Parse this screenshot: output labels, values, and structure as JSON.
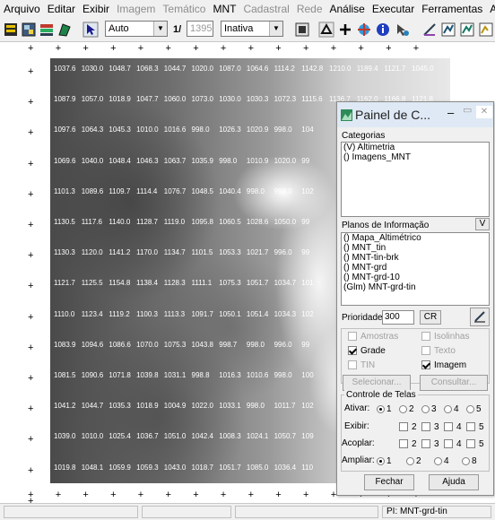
{
  "menu": [
    "Arquivo",
    "Editar",
    "Exibir",
    "Imagem",
    "Temático",
    "MNT",
    "Cadastral",
    "Rede",
    "Análise",
    "Executar",
    "Ferramentas",
    "Ajuda"
  ],
  "menu_disabled": [
    "Imagem",
    "Temático",
    "Cadastral",
    "Rede"
  ],
  "toolbar": {
    "mode_value": "Auto",
    "scale_prefix": "1/",
    "scale_value": "1395",
    "state_value": "Inativa"
  },
  "grid_rows": [
    [
      "1037.6",
      "1030.0",
      "1048.7",
      "1068.3",
      "1044.7",
      "1020.0",
      "1087.0",
      "1064.6",
      "1114.2",
      "1142.8",
      "1210.0",
      "1189.4",
      "1121.7",
      "1045.0"
    ],
    [
      "1087.9",
      "1057.0",
      "1018.9",
      "1047.7",
      "1060.0",
      "1073.0",
      "1030.0",
      "1030.3",
      "1072.3",
      "1115.6",
      "1136.7",
      "1162.0",
      "1166.8",
      "1121.8"
    ],
    [
      "1097.6",
      "1064.3",
      "1045.3",
      "1010.0",
      "1016.6",
      "998.0",
      "1026.3",
      "1020.9",
      "998.0",
      "104"
    ],
    [
      "1069.6",
      "1040.0",
      "1048.4",
      "1046.3",
      "1063.7",
      "1035.9",
      "998.0",
      "1010.9",
      "1020.0",
      "99"
    ],
    [
      "1101.3",
      "1089.6",
      "1109.7",
      "1114.4",
      "1076.7",
      "1048.5",
      "1040.4",
      "998.0",
      "998.0",
      "102"
    ],
    [
      "1130.5",
      "1117.6",
      "1140.0",
      "1128.7",
      "1119.0",
      "1095.8",
      "1060.5",
      "1028.6",
      "1050.0",
      "99"
    ],
    [
      "1130.3",
      "1120.0",
      "1141.2",
      "1170.0",
      "1134.7",
      "1101.5",
      "1053.3",
      "1021.7",
      "996.0",
      "99"
    ],
    [
      "1121.7",
      "1125.5",
      "1154.8",
      "1138.4",
      "1128.3",
      "1111.1",
      "1075.3",
      "1051.7",
      "1034.7",
      "101"
    ],
    [
      "1110.0",
      "1123.4",
      "1119.2",
      "1100.3",
      "1113.3",
      "1091.7",
      "1050.1",
      "1051.4",
      "1034.3",
      "102"
    ],
    [
      "1083.9",
      "1094.6",
      "1086.6",
      "1070.0",
      "1075.3",
      "1043.8",
      "998.7",
      "998.0",
      "996.0",
      "99"
    ],
    [
      "1081.5",
      "1090.6",
      "1071.8",
      "1039.8",
      "1031.1",
      "998.8",
      "1016.3",
      "1010.6",
      "998.0",
      "100"
    ],
    [
      "1041.2",
      "1044.7",
      "1035.3",
      "1018.9",
      "1004.9",
      "1022.0",
      "1033.1",
      "998.0",
      "1011.7",
      "102"
    ],
    [
      "1039.0",
      "1010.0",
      "1025.4",
      "1036.7",
      "1051.0",
      "1042.4",
      "1008.3",
      "1024.1",
      "1050.7",
      "109"
    ],
    [
      "1019.8",
      "1048.1",
      "1059.9",
      "1059.3",
      "1043.0",
      "1018.7",
      "1051.7",
      "1085.0",
      "1036.4",
      "110"
    ]
  ],
  "panel": {
    "title": "Painel de C...",
    "categories_label": "Categorias",
    "categories": [
      "(V) Altimetria",
      "() Imagens_MNT"
    ],
    "layers_label": "Planos de Informação",
    "layers_v": "V",
    "layers": [
      "() Mapa_Altimétrico",
      "() MNT_tin",
      "() MNT-tin-brk",
      "() MNT-grd",
      "() MNT-grd-10",
      "(Glm) MNT-grd-tin"
    ],
    "priority_label": "Prioridade:",
    "priority_value": "300",
    "cr_label": "CR",
    "chk_amostras": "Amostras",
    "chk_isolinhas": "Isolinhas",
    "chk_grade": "Grade",
    "chk_texto": "Texto",
    "chk_tin": "TIN",
    "chk_imagem": "Imagem",
    "selecionar": "Selecionar...",
    "consultar": "Consultar...",
    "controle_label": "Controle de Telas",
    "ativar_label": "Ativar:",
    "exibir_label": "Exibir:",
    "acoplar_label": "Acoplar:",
    "ampliar_label": "Ampliar:",
    "screens": [
      "1",
      "2",
      "3",
      "4",
      "5"
    ],
    "zooms": [
      "1",
      "2",
      "4",
      "8"
    ],
    "fechar": "Fechar",
    "ajuda": "Ajuda"
  },
  "status": {
    "right_text": "PI: MNT-grd-tin"
  },
  "colors": {
    "title_bar": "#dfe9f5",
    "map_dark": "#4a4a4a",
    "map_light": "#e8e8e8"
  }
}
